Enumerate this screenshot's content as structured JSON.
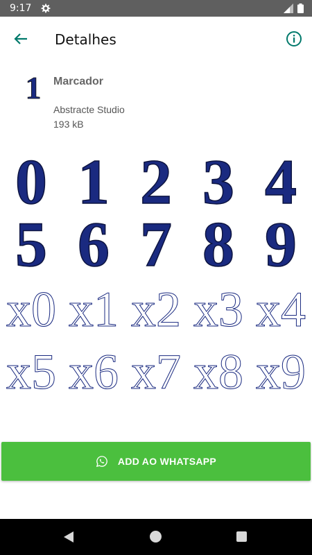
{
  "status_bar": {
    "time": "9:17"
  },
  "app_bar": {
    "title": "Detalhes"
  },
  "pack": {
    "tray_digit": "1",
    "name": "Marcador",
    "author": "Abstracte Studio",
    "size": "193 kB"
  },
  "stickers": {
    "filled_digits": [
      "0",
      "1",
      "2",
      "3",
      "4",
      "5",
      "6",
      "7",
      "8",
      "9"
    ],
    "outline_digits": [
      "x0",
      "x1",
      "x2",
      "x3",
      "x4",
      "x5",
      "x6",
      "x7",
      "x8",
      "x9"
    ]
  },
  "add_button": {
    "label": "ADD AO WHATSAPP"
  },
  "colors": {
    "accent": "#00796b",
    "button": "#4bbf3e",
    "navy": "#1a2a80",
    "gold": "#f0c419"
  }
}
